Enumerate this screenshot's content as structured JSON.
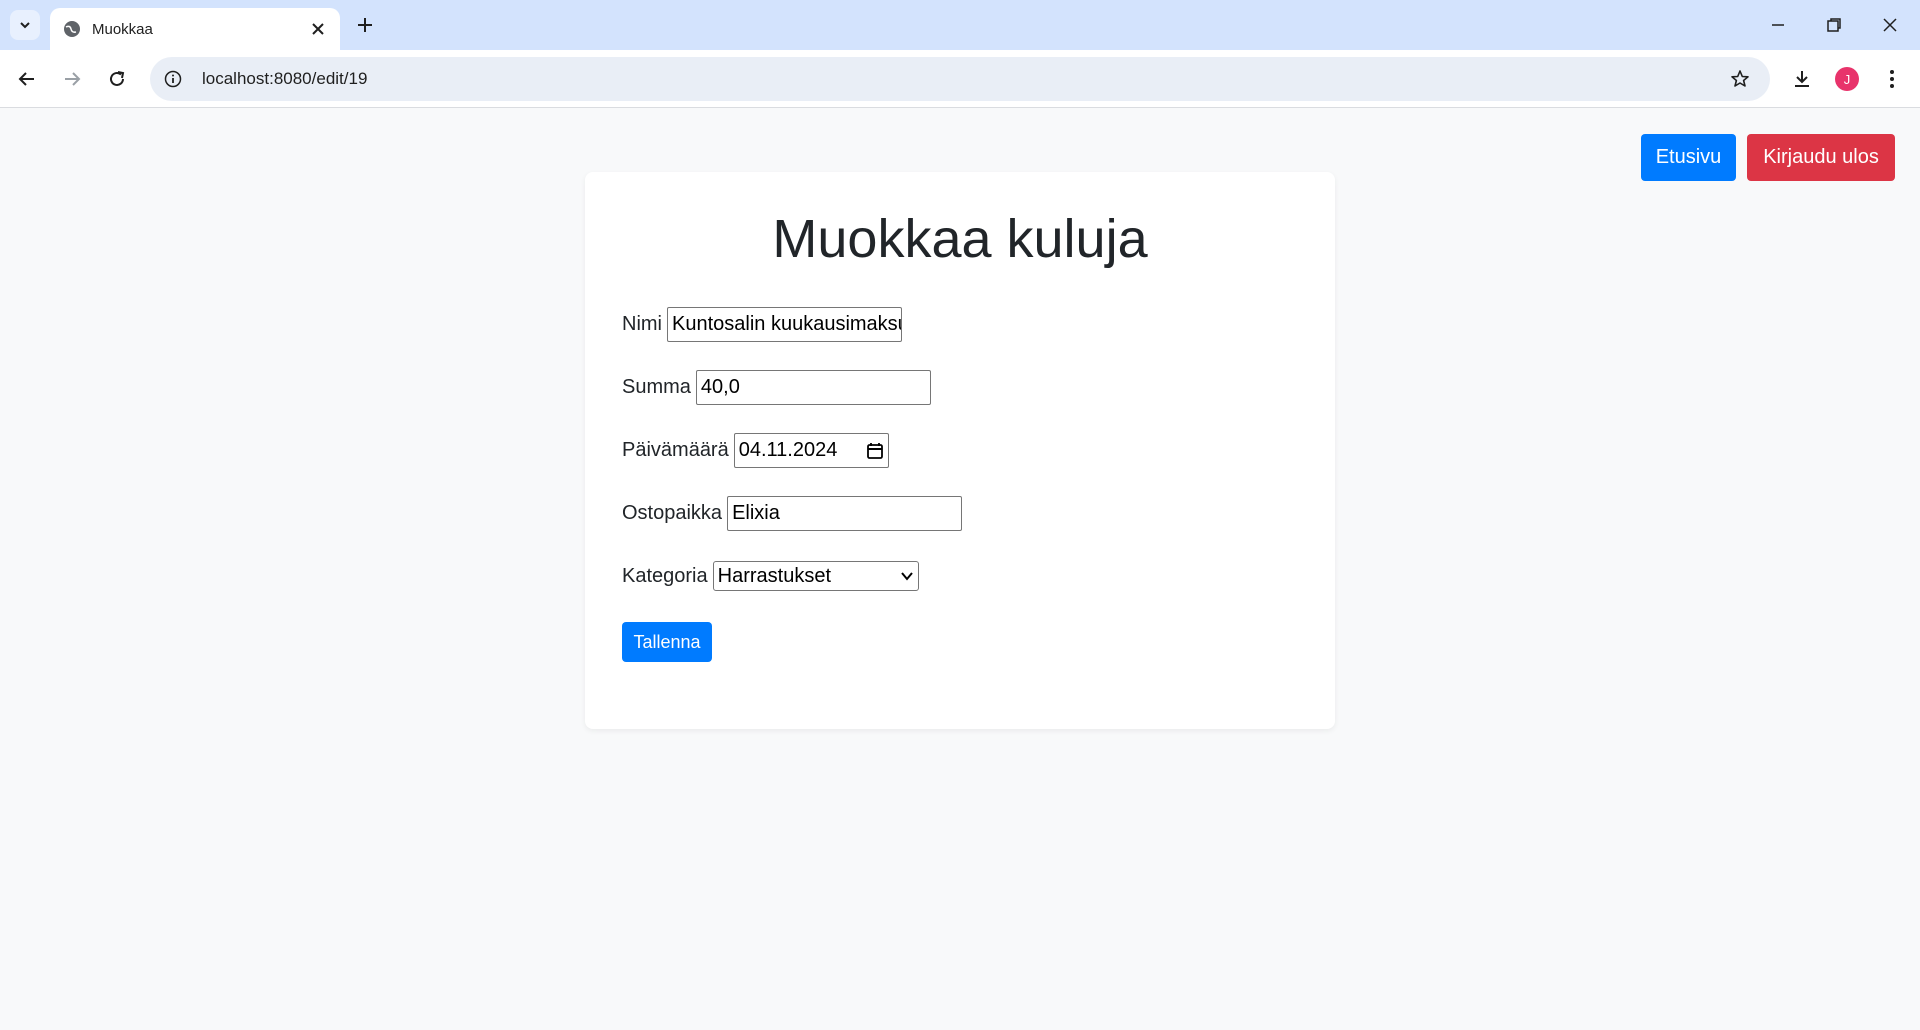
{
  "browser": {
    "tab_title": "Muokkaa",
    "url": "localhost:8080/edit/19",
    "profile_initial": "J"
  },
  "header": {
    "home_label": "Etusivu",
    "logout_label": "Kirjaudu ulos"
  },
  "form": {
    "title": "Muokkaa kuluja",
    "name_label": "Nimi",
    "name_value": "Kuntosalin kuukausimaksu",
    "amount_label": "Summa",
    "amount_value": "40,0",
    "date_label": "Päivämäärä",
    "date_value": "04.11.2024",
    "place_label": "Ostopaikka",
    "place_value": "Elixia",
    "category_label": "Kategoria",
    "category_value": "Harrastukset",
    "save_label": "Tallenna"
  },
  "colors": {
    "primary": "#007bff",
    "danger": "#dc3545"
  }
}
